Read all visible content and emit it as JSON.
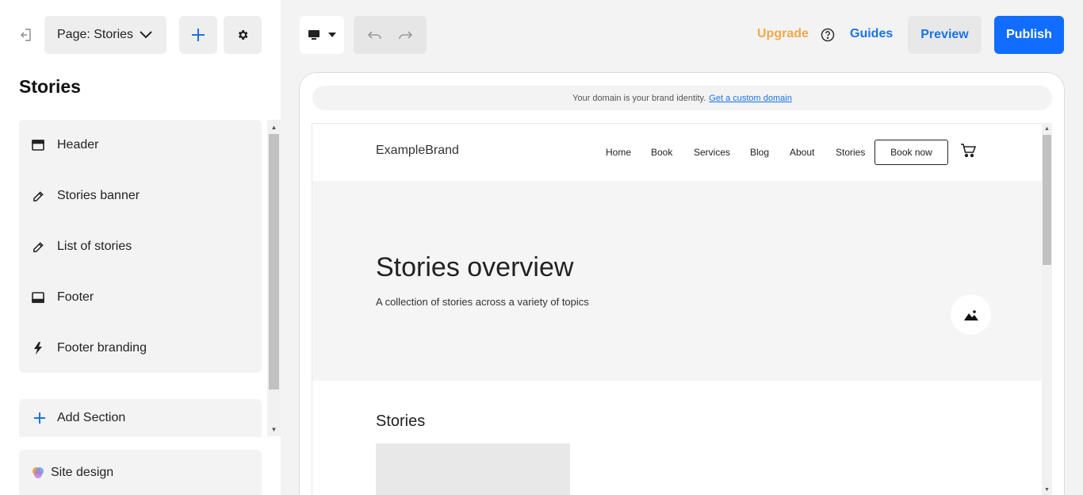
{
  "sidebar": {
    "page_select_label": "Page: Stories",
    "title": "Stories",
    "sections": [
      {
        "label": "Header",
        "icon": "header-layout-icon"
      },
      {
        "label": "Stories banner",
        "icon": "pencil-icon"
      },
      {
        "label": "List of stories",
        "icon": "pencil-icon"
      },
      {
        "label": "Footer",
        "icon": "footer-layout-icon"
      },
      {
        "label": "Footer branding",
        "icon": "lightning-icon"
      }
    ],
    "add_section_label": "Add Section",
    "site_design_label": "Site design"
  },
  "toolbar": {
    "upgrade_label": "Upgrade",
    "guides_label": "Guides",
    "preview_label": "Preview",
    "publish_label": "Publish",
    "accent_color": "#116dff",
    "upgrade_color": "#f0a84c"
  },
  "preview": {
    "domain_notice": "Your domain is your brand identity.",
    "domain_link": "Get a custom domain",
    "brand": "ExampleBrand",
    "nav": [
      "Home",
      "Book",
      "Services",
      "Blog",
      "About",
      "Stories"
    ],
    "book_now_label": "Book now",
    "banner_title": "Stories overview",
    "banner_subtitle": "A collection of stories across a variety of topics",
    "stories_heading": "Stories"
  }
}
